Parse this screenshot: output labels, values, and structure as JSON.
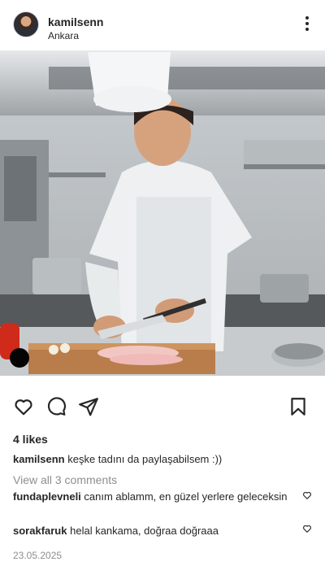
{
  "post": {
    "username": "kamilsenn",
    "location": "Ankara",
    "likes": "4 likes",
    "caption_user": "kamilsenn",
    "caption_text": "keşke tadını da paylaşabilsem :))",
    "view_all_comments": "View all 3 comments",
    "comments": [
      {
        "user": "fundaplevneli",
        "text": "canım ablamm, en güzel yerlere geleceksin"
      },
      {
        "user": "sorakfaruk",
        "text": "helal kankama, doğraa doğraaa"
      }
    ],
    "date": "23.05.2025"
  },
  "icons": {
    "more": "more-vertical-icon",
    "like": "heart-icon",
    "comment": "comment-icon",
    "share": "paper-plane-icon",
    "save": "bookmark-icon"
  },
  "colors": {
    "text": "#262626",
    "muted": "#8e8e8e",
    "background": "#ffffff"
  }
}
